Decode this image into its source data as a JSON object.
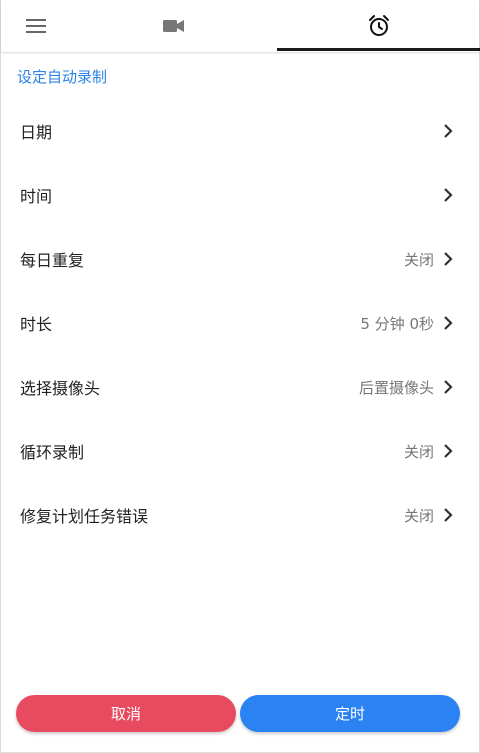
{
  "app": {
    "accent_color": "#2b82e6"
  },
  "tabs": [
    {
      "icon": "menu-icon",
      "active": false
    },
    {
      "icon": "video-camera-icon",
      "active": false
    },
    {
      "icon": "alarm-clock-icon",
      "active": true
    }
  ],
  "section_title": "设定自动录制",
  "settings": [
    {
      "label": "日期",
      "value": ""
    },
    {
      "label": "时间",
      "value": ""
    },
    {
      "label": "每日重复",
      "value": "关闭"
    },
    {
      "label": "时长",
      "value": "5 分钟 0秒"
    },
    {
      "label": "选择摄像头",
      "value": "后置摄像头"
    },
    {
      "label": "循环录制",
      "value": "关闭"
    },
    {
      "label": "修复计划任务错误",
      "value": "关闭"
    }
  ],
  "buttons": {
    "cancel": {
      "label": "取消",
      "color": "#e84a5f"
    },
    "confirm": {
      "label": "定时",
      "color": "#2a82f3"
    }
  }
}
